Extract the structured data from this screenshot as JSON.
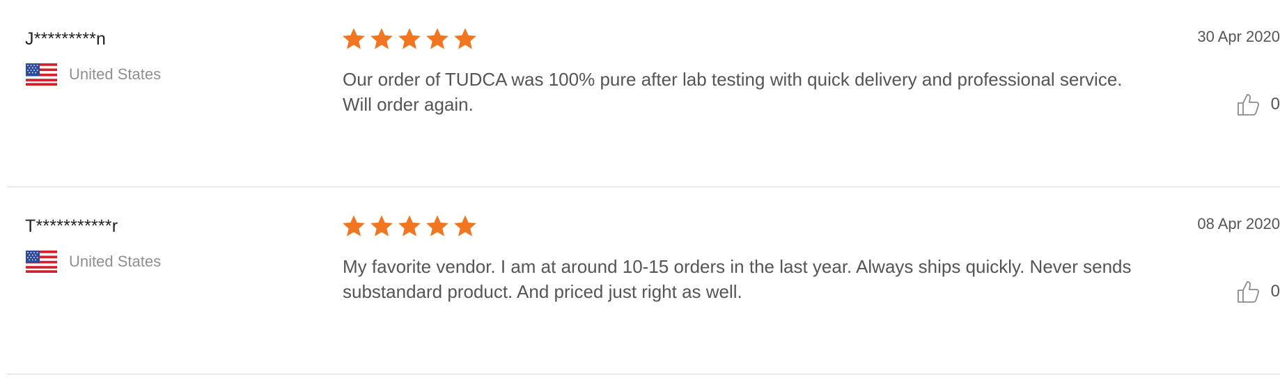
{
  "colors": {
    "star": "#f07622",
    "text": "#555555",
    "divider": "#d9d9d9"
  },
  "reviews": [
    {
      "name": "J*********n",
      "country": "United States",
      "flag_icon": "us-flag-icon",
      "rating": 5,
      "text": "Our order of TUDCA was 100% pure after lab testing with quick delivery and professional service. Will order again.",
      "date": "30 Apr 2020",
      "likes": "0"
    },
    {
      "name": "T***********r",
      "country": "United States",
      "flag_icon": "us-flag-icon",
      "rating": 5,
      "text": "My favorite vendor. I am at around 10-15 orders in the last year. Always ships quickly. Never sends substandard product.  And priced just right as well.",
      "date": "08 Apr 2020",
      "likes": "0"
    }
  ]
}
